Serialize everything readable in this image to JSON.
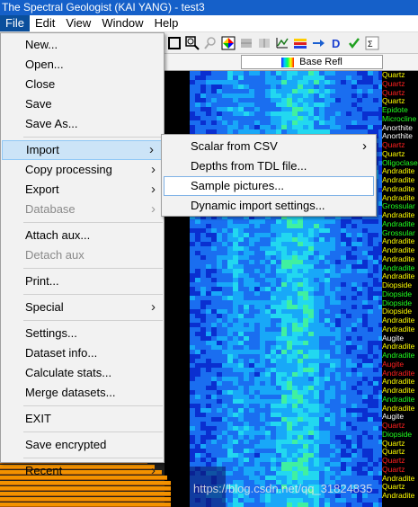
{
  "window": {
    "title": "The Spectral Geologist  (KAI YANG)  - test3"
  },
  "menubar": [
    "File",
    "Edit",
    "View",
    "Window",
    "Help"
  ],
  "toolbar_icons": [
    "select-box-icon",
    "zoom-icon",
    "magnifier-icon",
    "color-wheel-icon",
    "grid-icon",
    "table-icon",
    "chart-icon",
    "color-bars-icon",
    "arrow-right-icon",
    "d-icon",
    "check-icon",
    "scalar-icon"
  ],
  "column_header": {
    "label": "Base Refl"
  },
  "file_menu": {
    "items": [
      {
        "label": "New...",
        "type": "item"
      },
      {
        "label": "Open...",
        "type": "item"
      },
      {
        "label": "Close",
        "type": "item"
      },
      {
        "label": "Save",
        "type": "item"
      },
      {
        "label": "Save As...",
        "type": "item"
      },
      {
        "type": "sep"
      },
      {
        "label": "Import",
        "type": "item",
        "submenu": true,
        "highlight": true
      },
      {
        "label": "Copy processing",
        "type": "item",
        "submenu": true
      },
      {
        "label": "Export",
        "type": "item",
        "submenu": true
      },
      {
        "label": "Database",
        "type": "item",
        "submenu": true,
        "disabled": true
      },
      {
        "type": "sep"
      },
      {
        "label": "Attach aux...",
        "type": "item"
      },
      {
        "label": "Detach aux",
        "type": "item",
        "disabled": true
      },
      {
        "type": "sep"
      },
      {
        "label": "Print...",
        "type": "item"
      },
      {
        "type": "sep"
      },
      {
        "label": "Special",
        "type": "item",
        "submenu": true
      },
      {
        "type": "sep"
      },
      {
        "label": "Settings...",
        "type": "item"
      },
      {
        "label": "Dataset info...",
        "type": "item"
      },
      {
        "label": "Calculate stats...",
        "type": "item"
      },
      {
        "label": "Merge datasets...",
        "type": "item"
      },
      {
        "type": "sep"
      },
      {
        "label": "EXIT",
        "type": "item"
      },
      {
        "type": "sep"
      },
      {
        "label": "Save encrypted",
        "type": "item"
      },
      {
        "type": "sep"
      },
      {
        "label": "Recent",
        "type": "item",
        "submenu": true
      }
    ]
  },
  "import_submenu": {
    "items": [
      {
        "label": "Scalar from CSV",
        "submenu": true
      },
      {
        "label": "Depths from TDL file..."
      },
      {
        "label": "Sample pictures...",
        "highlight": true
      },
      {
        "label": "Dynamic import settings..."
      }
    ]
  },
  "minerals": [
    {
      "name": "Quartz",
      "color": "#ffff00"
    },
    {
      "name": "Quartz",
      "color": "#ff2020"
    },
    {
      "name": "Quartz",
      "color": "#ff2020"
    },
    {
      "name": "Quartz",
      "color": "#ffff00"
    },
    {
      "name": "Epidote",
      "color": "#20ff20"
    },
    {
      "name": "Microcline",
      "color": "#20ff20"
    },
    {
      "name": "Anorthite",
      "color": "#ffffff"
    },
    {
      "name": "Anorthite",
      "color": "#ffffff"
    },
    {
      "name": "Quartz",
      "color": "#ff2020"
    },
    {
      "name": "Quartz",
      "color": "#ffff00"
    },
    {
      "name": "Oligoclase",
      "color": "#20ff20"
    },
    {
      "name": "Andradite",
      "color": "#ffff00"
    },
    {
      "name": "Andradite",
      "color": "#ffff00"
    },
    {
      "name": "Andradite",
      "color": "#ffff00"
    },
    {
      "name": "Andradite",
      "color": "#ffff00"
    },
    {
      "name": "Grossular",
      "color": "#20ff20"
    },
    {
      "name": "Andradite",
      "color": "#ffff00"
    },
    {
      "name": "Andradite",
      "color": "#20ff20"
    },
    {
      "name": "Grossular",
      "color": "#20ff20"
    },
    {
      "name": "Andradite",
      "color": "#ffff00"
    },
    {
      "name": "Andradite",
      "color": "#ffff00"
    },
    {
      "name": "Andradite",
      "color": "#ffff00"
    },
    {
      "name": "Andradite",
      "color": "#20ff20"
    },
    {
      "name": "Andradite",
      "color": "#ffff00"
    },
    {
      "name": "Diopside",
      "color": "#ffff00"
    },
    {
      "name": "Diopside",
      "color": "#20ff20"
    },
    {
      "name": "Diopside",
      "color": "#20ff20"
    },
    {
      "name": "Diopside",
      "color": "#ffff00"
    },
    {
      "name": "Andradite",
      "color": "#ffff00"
    },
    {
      "name": "Andradite",
      "color": "#ffff00"
    },
    {
      "name": "Augite",
      "color": "#ffffff"
    },
    {
      "name": "Andradite",
      "color": "#ffff00"
    },
    {
      "name": "Andradite",
      "color": "#20ff20"
    },
    {
      "name": "Augite",
      "color": "#ff2020"
    },
    {
      "name": "Andradite",
      "color": "#ff2020"
    },
    {
      "name": "Andradite",
      "color": "#ffff00"
    },
    {
      "name": "Andradite",
      "color": "#ffff00"
    },
    {
      "name": "Andradite",
      "color": "#20ff20"
    },
    {
      "name": "Andradite",
      "color": "#ffff00"
    },
    {
      "name": "Augite",
      "color": "#ffffff"
    },
    {
      "name": "Quartz",
      "color": "#ff2020"
    },
    {
      "name": "Diopside",
      "color": "#20ff20"
    },
    {
      "name": "Quartz",
      "color": "#ffff00"
    },
    {
      "name": "Quartz",
      "color": "#ffff00"
    },
    {
      "name": "Quartz",
      "color": "#ff2020"
    },
    {
      "name": "Quartz",
      "color": "#ff2020"
    },
    {
      "name": "Andradite",
      "color": "#ffff00"
    },
    {
      "name": "Quartz",
      "color": "#ffff00"
    },
    {
      "name": "Andradite",
      "color": "#ffff00"
    }
  ],
  "watermark": "https://blog.csdn.net/qq_31824835"
}
